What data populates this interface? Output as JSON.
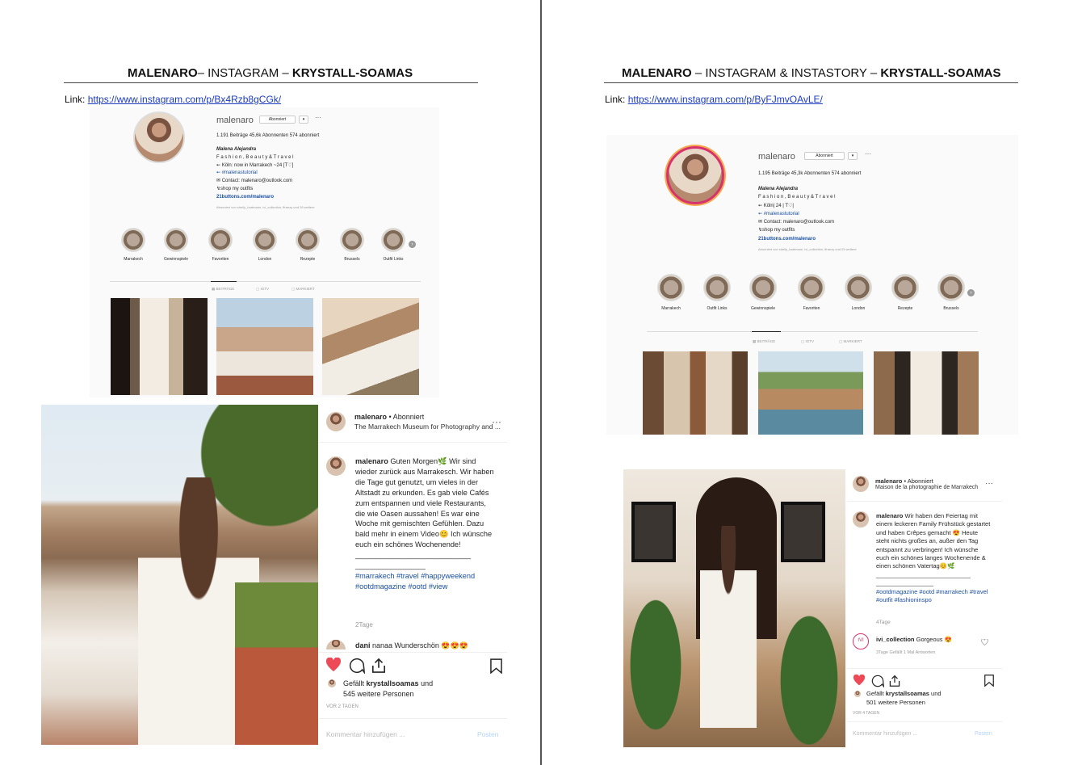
{
  "left": {
    "title": {
      "a": "MALENARO",
      "b": "– INSTAGRAM – ",
      "c": "KRYSTALL-SOAMAS"
    },
    "link_label": "Link: ",
    "link_url": "https://www.instagram.com/p/Bx4Rzb8gCGk/",
    "profile": {
      "username": "malenaro",
      "follow_btn": "Abonniert",
      "stats": "1.191 Beiträge      45,6k Abonnenten      574 abonniert",
      "bio_name": "Malena Alejandra",
      "bio_lines": [
        "F a s h i o n ,  B e a u t y  &  T r a v e l",
        "⇜ Köln: now in Marrakech ~24 [T♡]",
        "⇜ #malenastutorial",
        "✉ Contact: malenaro@outlook.com",
        "↯shop my outfits"
      ],
      "bio_link": "21buttons.com/malenaro",
      "followed_by": "Abonniert von shelly_hartmann, ivi_collection, ffranzy und 26 weitere",
      "highlights": [
        "Marrakech",
        "Gewinnspiele",
        "Favoriten",
        "London",
        "Rezepte",
        "Brussels",
        "Outfit Links"
      ],
      "tabs": [
        "▦ BEITRÄGE",
        "▢ IGTV",
        "▢ MARKIERT"
      ]
    },
    "post": {
      "username": "malenaro",
      "follow": " • Abonniert",
      "location": "The Marrakech Museum for Photography and ...",
      "caption_user": "malenaro",
      "caption": " Guten Morgen🌿 Wir sind wieder zurück aus Marrakesch. Wir haben die Tage gut genutzt, um vieles in der Altstadt zu erkunden. Es gab viele Cafés zum entspannen und viele Restaurants, die wie Oasen aussahen! Es war eine Woche mit gemischten Gefühlen. Dazu bald mehr in einem Video😊 Ich wünsche euch ein schönes Wochenende!",
      "separator": "____________________________ _________________",
      "hashtags": "#marrakech #travel #happyweekend #ootdmagazine #ootd #view",
      "time": "2Tage",
      "comment_user": "dani",
      "comment": " nanaa Wunderschön 😍😍😍",
      "likes_line1": "Gefällt ",
      "likes_user": "krystallsoamas",
      "likes_line1b": " und",
      "likes_line2": "545 weitere Personen",
      "date": "VOR 2 TAGEN",
      "add_comment": "Kommentar hinzufügen ...",
      "post_btn": "Posten"
    }
  },
  "right": {
    "title": {
      "a": "MALENARO",
      "b": " – INSTAGRAM & INSTASTORY – ",
      "c": "KRYSTALL-SOAMAS"
    },
    "link_label": "Link: ",
    "link_url": "https://www.instagram.com/p/ByFJmvOAvLE/",
    "profile": {
      "username": "malenaro",
      "follow_btn": "Abonniert",
      "stats": "1.195 Beiträge      45,3k Abonnenten      574 abonniert",
      "bio_name": "Malena Alejandra",
      "bio_lines": [
        "F a s h i o n ,  B e a u t y  &  T r a v e l",
        "⇜ Köln| 24 | T♡|",
        "⇜ #malenastutorial",
        "✉ Contact: malenaro@outlook.com",
        "↯shop my outfits"
      ],
      "bio_link": "21buttons.com/malenaro",
      "followed_by": "Abonniert von shelly_hartmann, ivi_collection, ffranzy und 25 weitere",
      "highlights": [
        "Marrakech",
        "Outfit Links",
        "Gewinnspiele",
        "Favoriten",
        "London",
        "Rezepte",
        "Brussels"
      ],
      "tabs": [
        "▦ BEITRÄGE",
        "▢ IGTV",
        "▢ MARKIERT"
      ]
    },
    "post": {
      "username": "malenaro",
      "follow": " • Abonniert",
      "location": "Maison de la photographie de Marrakech",
      "caption_user": "malenaro",
      "caption": " Wir haben den Feiertag mit einem leckeren Family Frühstück gestartet und haben Crêpes gemacht 😍 Heute steht nichts großes an, außer den Tag entspannt zu verbringen! Ich wünsche euch ein schönes langes Wochenende & einen schönen Vatertag😊🌿",
      "separator": "____________________________ _________________",
      "hashtags": "#ootdmagazine #ootd #marrakech #travel #outfit #fashioninspo",
      "time": "4Tage",
      "comment_user": "ivi_collection",
      "comment": " Gorgeous 😍",
      "comment_meta": "3Tage   Gefällt 1 Mal   Antworten",
      "likes_line1": "Gefällt ",
      "likes_user": "krystallsoamas",
      "likes_line1b": " und",
      "likes_line2": "501 weitere Personen",
      "date": "VOR 4 TAGEN",
      "add_comment": "Kommentar hinzufügen ...",
      "post_btn": "Posten"
    }
  }
}
